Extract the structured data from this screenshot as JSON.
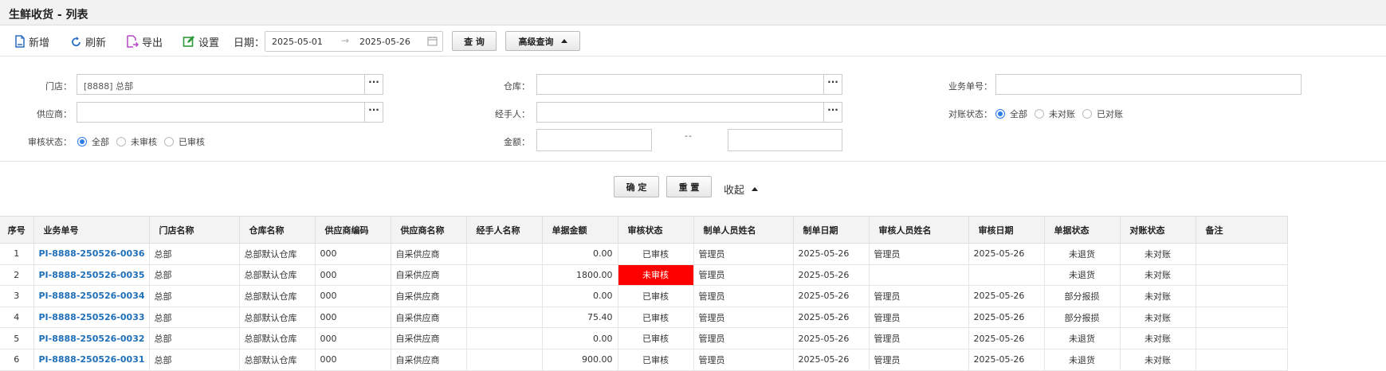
{
  "title": "生鲜收货 - 列表",
  "toolbar": {
    "add": "新增",
    "refresh": "刷新",
    "export": "导出",
    "settings": "设置",
    "date_label": "日期：",
    "date_from": "2025-05-01",
    "date_sep": "→",
    "date_to": "2025-05-26",
    "query": "查 询",
    "advanced": "高级查询"
  },
  "filter": {
    "store_label": "门店：",
    "store_value": "[8888] 总部",
    "supplier_label": "供应商：",
    "audit_label": "审核状态：",
    "audit_options": [
      "全部",
      "未审核",
      "已审核"
    ],
    "warehouse_label": "仓库：",
    "handler_label": "经手人：",
    "amount_label": "金额：",
    "amount_sep": "--",
    "bizno_label": "业务单号：",
    "recon_label": "对账状态：",
    "recon_options": [
      "全部",
      "未对账",
      "已对账"
    ],
    "more": "···"
  },
  "actions": {
    "confirm": "确 定",
    "reset": "重 置",
    "collapse": "收起"
  },
  "table": {
    "headers": [
      "序号",
      "业务单号",
      "门店名称",
      "仓库名称",
      "供应商编码",
      "供应商名称",
      "经手人名称",
      "单据金额",
      "审核状态",
      "制单人员姓名",
      "制单日期",
      "审核人员姓名",
      "审核日期",
      "单据状态",
      "对账状态",
      "备注"
    ],
    "rows": [
      [
        "1",
        "PI-8888-250526-0036",
        "总部",
        "总部默认仓库",
        "000",
        "自采供应商",
        "",
        "0.00",
        "已审核",
        "管理员",
        "2025-05-26",
        "管理员",
        "2025-05-26",
        "未退货",
        "未对账",
        ""
      ],
      [
        "2",
        "PI-8888-250526-0035",
        "总部",
        "总部默认仓库",
        "000",
        "自采供应商",
        "",
        "1800.00",
        "未审核",
        "管理员",
        "2025-05-26",
        "",
        "",
        "未退货",
        "未对账",
        ""
      ],
      [
        "3",
        "PI-8888-250526-0034",
        "总部",
        "总部默认仓库",
        "000",
        "自采供应商",
        "",
        "0.00",
        "已审核",
        "管理员",
        "2025-05-26",
        "管理员",
        "2025-05-26",
        "部分报损",
        "未对账",
        ""
      ],
      [
        "4",
        "PI-8888-250526-0033",
        "总部",
        "总部默认仓库",
        "000",
        "自采供应商",
        "",
        "75.40",
        "已审核",
        "管理员",
        "2025-05-26",
        "管理员",
        "2025-05-26",
        "部分报损",
        "未对账",
        ""
      ],
      [
        "5",
        "PI-8888-250526-0032",
        "总部",
        "总部默认仓库",
        "000",
        "自采供应商",
        "",
        "0.00",
        "已审核",
        "管理员",
        "2025-05-26",
        "管理员",
        "2025-05-26",
        "未退货",
        "未对账",
        ""
      ],
      [
        "6",
        "PI-8888-250526-0031",
        "总部",
        "总部默认仓库",
        "000",
        "自采供应商",
        "",
        "900.00",
        "已审核",
        "管理员",
        "2025-05-26",
        "管理员",
        "2025-05-26",
        "未退货",
        "未对账",
        ""
      ]
    ],
    "highlight_color": "#ff0000"
  }
}
